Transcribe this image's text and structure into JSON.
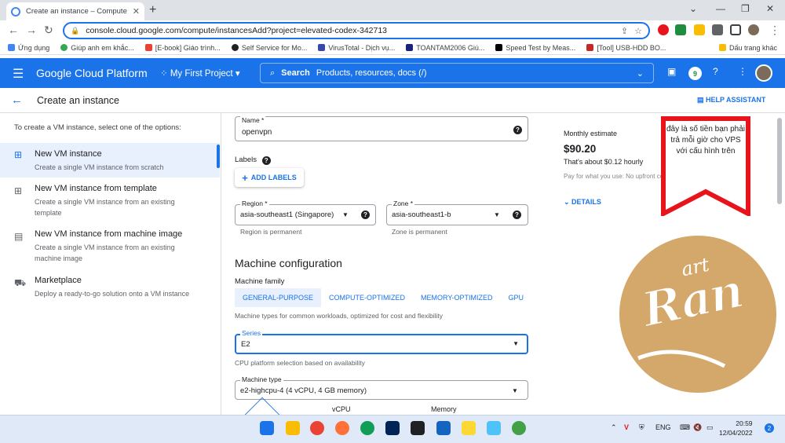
{
  "browser": {
    "tab_title": "Create an instance – Compute En",
    "url": "console.cloud.google.com/compute/instancesAdd?project=elevated-codex-342713",
    "bookmarks": [
      "Ứng dụng",
      "Giúp anh em khắc...",
      "[E-book] Giáo trình...",
      "Self Service for Mo...",
      "VirusTotal - Dịch vụ...",
      "TOANTAM2006 Giú...",
      "Speed Test by Meas...",
      "[Tool] USB-HDD BO..."
    ],
    "bookmarks_other": "Dấu trang khác"
  },
  "header": {
    "brand": "Google Cloud Platform",
    "project": "My First Project",
    "search_label": "Search",
    "search_hint": "Products, resources, docs (/)",
    "notif_count": "9"
  },
  "subheader": {
    "title": "Create an instance",
    "help": "HELP ASSISTANT"
  },
  "left": {
    "intro": "To create a VM instance, select one of the options:",
    "options": [
      {
        "title": "New VM instance",
        "desc": "Create a single VM instance from scratch"
      },
      {
        "title": "New VM instance from template",
        "desc": "Create a single VM instance from an existing template"
      },
      {
        "title": "New VM instance from machine image",
        "desc": "Create a single VM instance from an existing machine image"
      },
      {
        "title": "Marketplace",
        "desc": "Deploy a ready-to-go solution onto a VM instance"
      }
    ]
  },
  "form": {
    "name_label": "Name *",
    "name_value": "openvpn",
    "labels_heading": "Labels",
    "add_labels": "ADD LABELS",
    "region_label": "Region *",
    "region_value": "asia-southeast1 (Singapore)",
    "region_hint": "Region is permanent",
    "zone_label": "Zone *",
    "zone_value": "asia-southeast1-b",
    "zone_hint": "Zone is permanent",
    "machine_config": "Machine configuration",
    "machine_family": "Machine family",
    "families": [
      "GENERAL-PURPOSE",
      "COMPUTE-OPTIMIZED",
      "MEMORY-OPTIMIZED",
      "GPU"
    ],
    "family_desc": "Machine types for common workloads, optimized for cost and flexibility",
    "series_label": "Series",
    "series_value": "E2",
    "cpu_hint": "CPU platform selection based on availability",
    "mtype_label": "Machine type",
    "mtype_value": "e2-highcpu-4 (4 vCPU, 4 GB memory)",
    "vcpu": "vCPU",
    "memory": "Memory"
  },
  "estimate": {
    "heading": "Monthly estimate",
    "value": "$90.20",
    "hourly": "That's about $0.12 hourly",
    "note": "Pay for what you use: No upfront costs and per second billing",
    "details": "DETAILS"
  },
  "annotation": "đây là số tiền bạn phải trả mỗi giờ cho VPS với cấu hình trên",
  "logo": {
    "small": "art",
    "big": "Ran"
  },
  "taskbar": {
    "lang": "ENG",
    "time": "20:59",
    "date": "12/04/2022",
    "notif": "2"
  },
  "colors": {
    "accent": "#1a73e8",
    "annotation": "#e8141c",
    "logo": "#d4a86a"
  }
}
